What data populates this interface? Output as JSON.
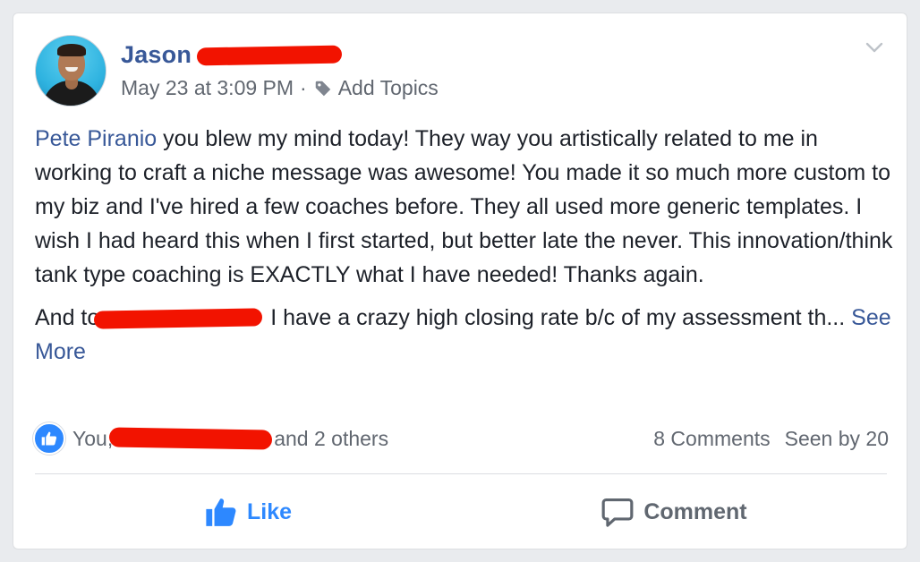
{
  "post": {
    "author": {
      "first_name": "Jason",
      "last_name_redacted": true
    },
    "timestamp": "May 23 at 3:09 PM",
    "separator": "·",
    "add_topics_label": "Add Topics",
    "mention": "Pete Piranio",
    "paragraph1_rest": " you blew my mind today! They way you artistically related to me in working to craft a niche message was awesome! You made it so much more custom to my biz and I've hired a few coaches before. They all used more generic templates. I wish I had heard this when I first started, but better late the never. This innovation/think tank type coaching is EXACTLY what I have needed! Thanks again.",
    "paragraph2_start": "And to",
    "paragraph2_after_redaction": " I have a crazy high closing rate b/c of my assessment th... ",
    "see_more_label": "See More"
  },
  "reactions": {
    "icon": "thumbs-up-icon",
    "prefix": "You,",
    "suffix": "and 2 others",
    "comments_count": "8 Comments",
    "seen_by": "Seen by 20"
  },
  "actions": {
    "like_label": "Like",
    "comment_label": "Comment"
  },
  "colors": {
    "link": "#385898",
    "like_blue": "#2d88ff",
    "redaction": "#f21300",
    "secondary_text": "#616770"
  }
}
